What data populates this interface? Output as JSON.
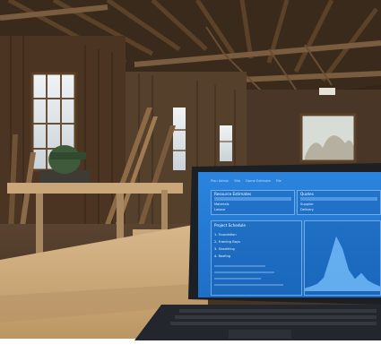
{
  "scene": {
    "description_hidden": "",
    "palette": {
      "wood_dark": "#3b2a1c",
      "wood_mid": "#7a5c3e",
      "wood_light": "#c9a77b",
      "window_sky": "#dfe6ea",
      "screen_blue": "#2a84de",
      "laptop_body": "#1c1f24"
    }
  },
  "laptop_screen": {
    "nav": [
      "Plan Admin",
      "Site",
      "Dome Estimate",
      "File"
    ],
    "panel_left": {
      "title": "Resource Estimates",
      "rows": [
        {
          "label": "Materials",
          "value": ""
        },
        {
          "label": "Labour",
          "value": ""
        }
      ]
    },
    "panel_right": {
      "title": "Quotes",
      "rows": [
        {
          "label": "Supplier",
          "value": ""
        },
        {
          "label": "Delivery",
          "value": ""
        }
      ]
    },
    "panel_lower_left": {
      "title": "Project Schedule",
      "lines": [
        "1. Foundation",
        "2. Framing Bays",
        "3. Sheathing",
        "4. Roofing"
      ]
    },
    "panel_lower_right": {
      "chart_kind": "area",
      "values": [
        0.05,
        0.08,
        0.12,
        0.22,
        0.55,
        0.9,
        0.7,
        0.35,
        0.2,
        0.3,
        0.18,
        0.12,
        0.08
      ]
    }
  }
}
